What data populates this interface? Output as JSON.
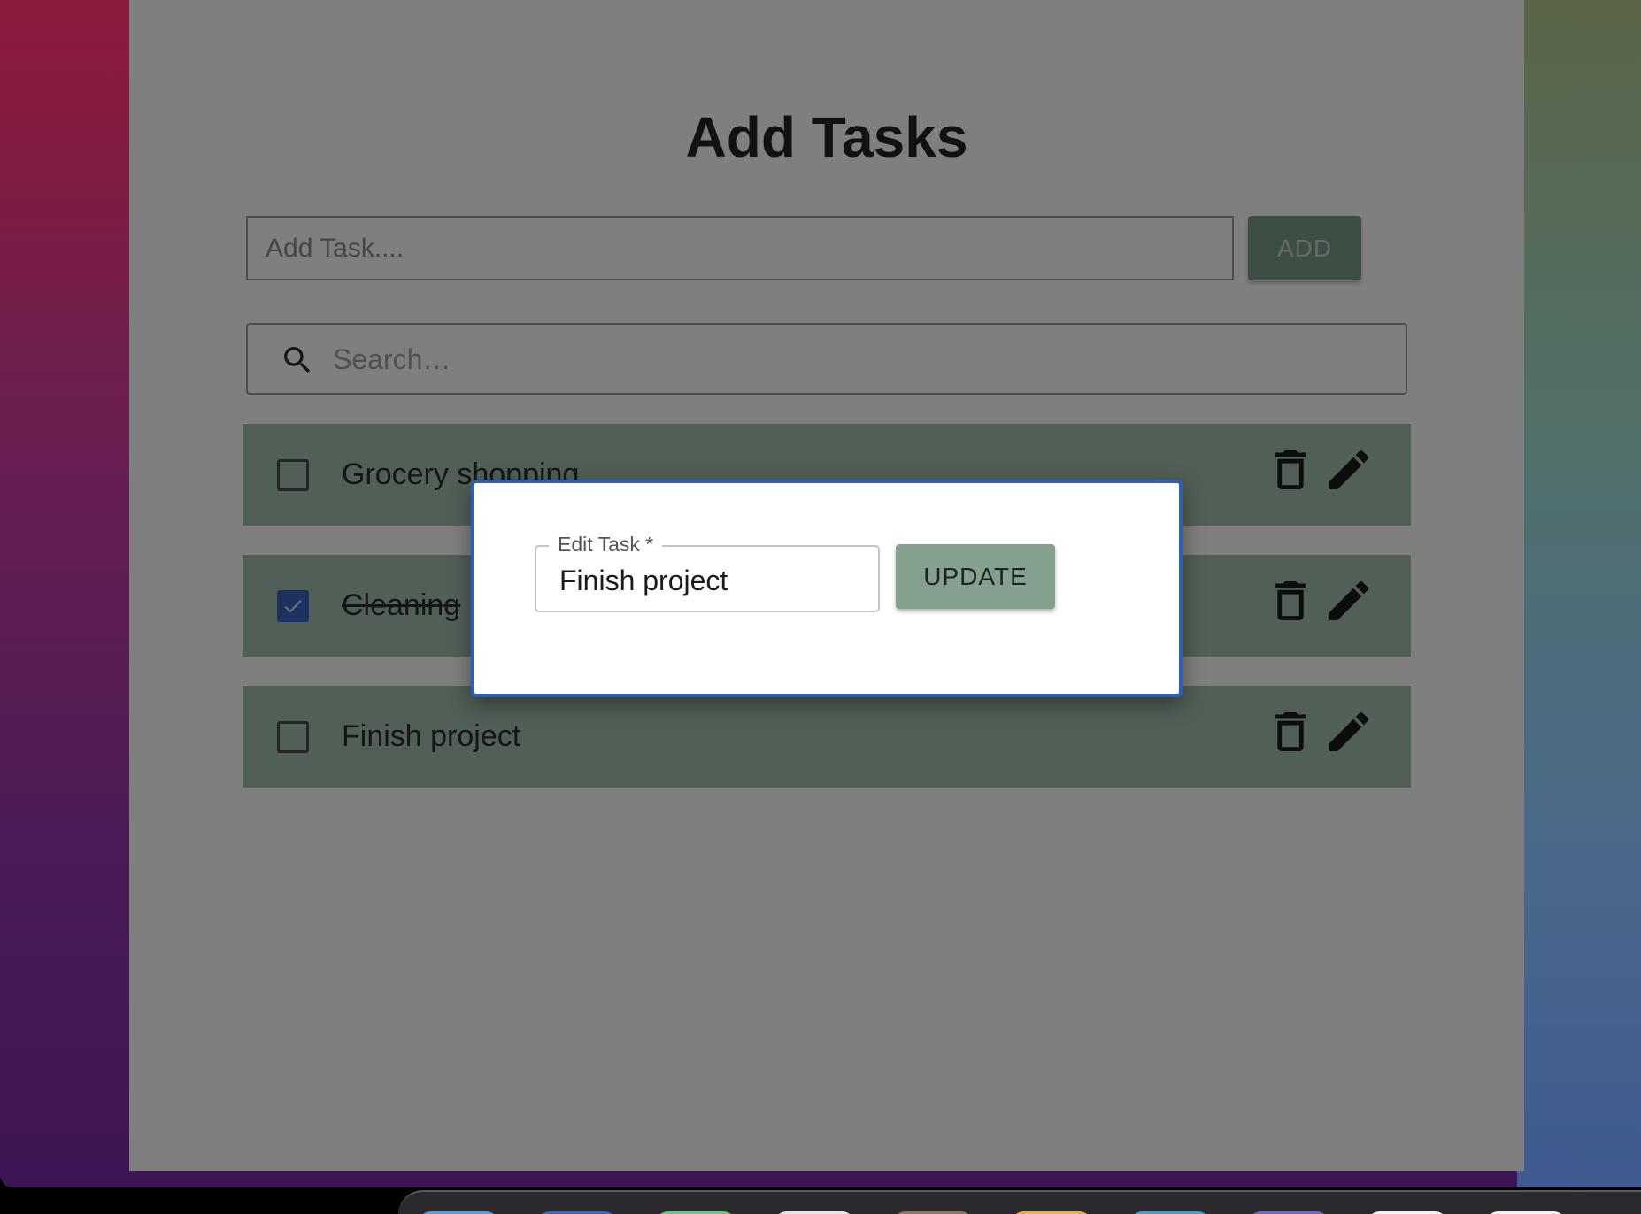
{
  "header": {
    "title": "Add Tasks"
  },
  "add_form": {
    "placeholder": "Add Task....",
    "button_label": "ADD"
  },
  "search": {
    "placeholder": "Search…"
  },
  "tasks": [
    {
      "label": "Grocery shopping",
      "completed": false
    },
    {
      "label": "Cleaning",
      "completed": true
    },
    {
      "label": "Finish project",
      "completed": false
    }
  ],
  "modal": {
    "field_label": "Edit Task *",
    "field_value": "Finish project",
    "button_label": "UPDATE"
  },
  "colors": {
    "accent": "#86a08f",
    "row_background": "#a3bfae",
    "checkbox_checked": "#3b63c6",
    "modal_border": "#2f5fb3"
  },
  "icons": {
    "search": "search-icon",
    "delete": "trash-icon",
    "edit": "pencil-icon",
    "check": "check-icon"
  }
}
